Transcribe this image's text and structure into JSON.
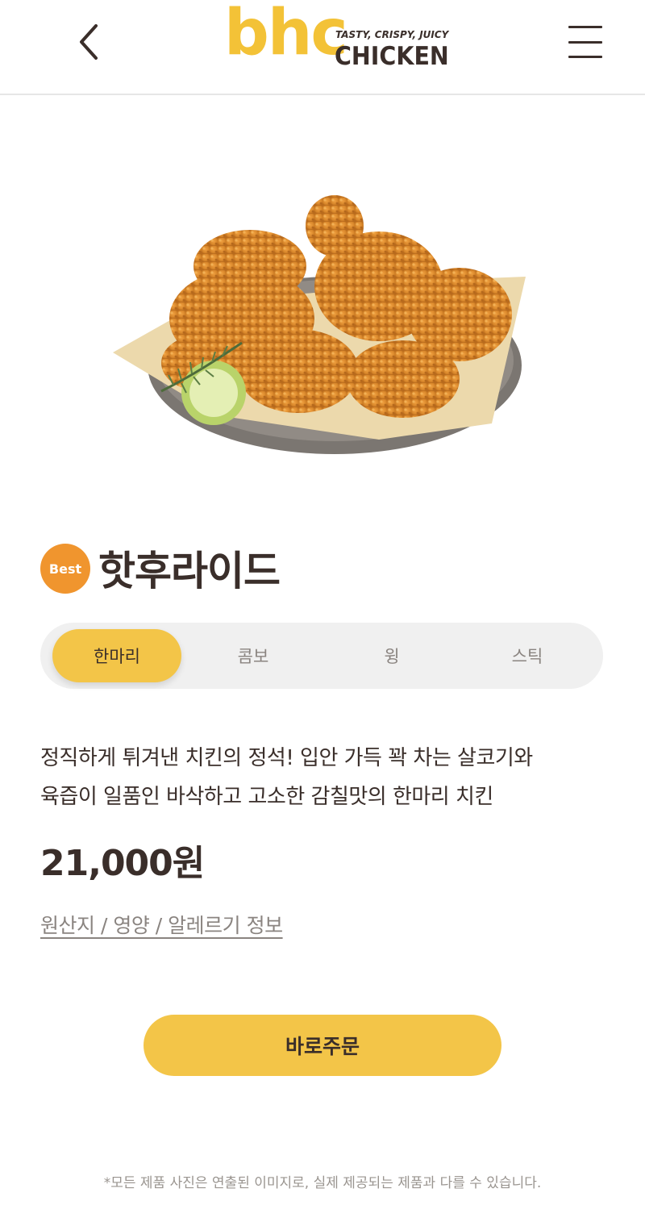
{
  "header": {
    "back_icon": "chevron-left-icon",
    "logo": {
      "brand": "bhc",
      "tagline": "TASTY, CRISPY, JUICY",
      "sub": "CHICKEN"
    },
    "menu_icon": "hamburger-menu-icon"
  },
  "product": {
    "badge": "Best",
    "title": "핫후라이드",
    "tabs": [
      {
        "label": "한마리",
        "active": true
      },
      {
        "label": "콤보",
        "active": false
      },
      {
        "label": "윙",
        "active": false
      },
      {
        "label": "스틱",
        "active": false
      }
    ],
    "description_lines": [
      "정직하게 튀겨낸 치킨의 정석! 입안 가득 꽉 차는 살코기와",
      "육즙이 일품인 바삭하고 고소한 감칠맛의 한마리 치킨"
    ],
    "price": "21,000원",
    "info_link": "원산지 / 영양 / 알레르기 정보",
    "order_button": "바로주문"
  },
  "disclaimer": "*모든 제품 사진은 연출된 이미지로, 실제 제공되는 제품과 다를 수 있습니다.",
  "colors": {
    "brand_yellow": "#f3c548",
    "brand_dark": "#3a2e2a",
    "badge_orange": "#f0952e"
  }
}
